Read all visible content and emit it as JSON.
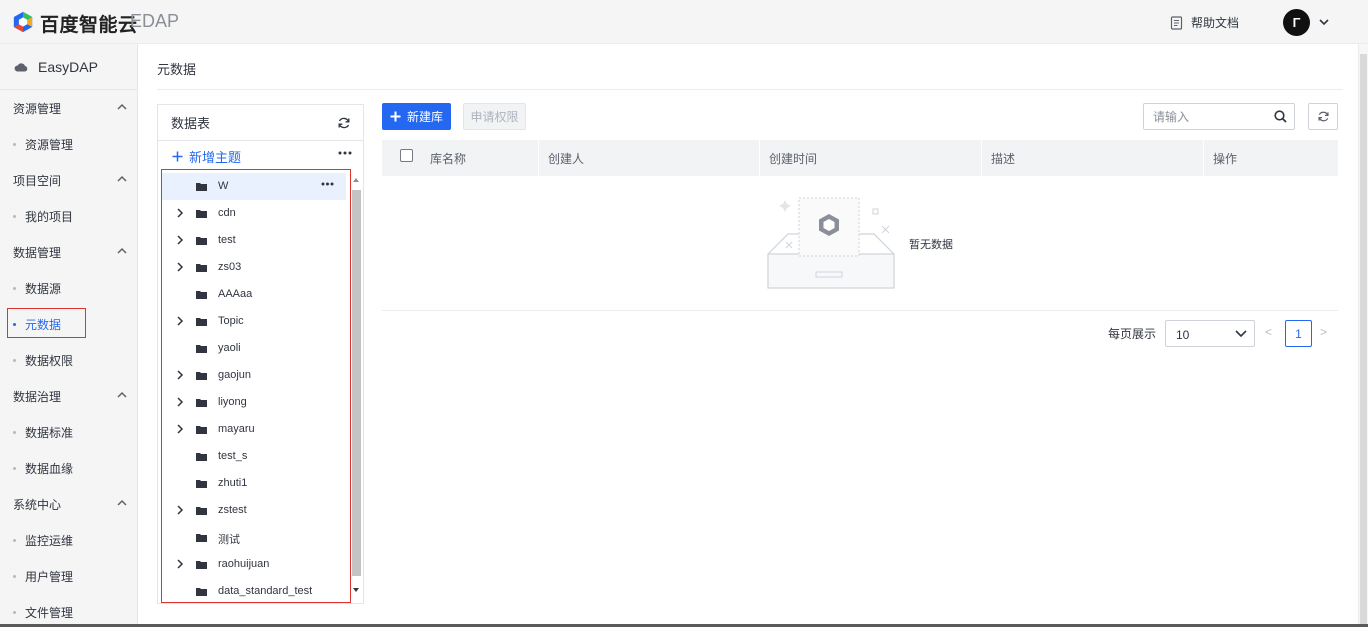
{
  "header": {
    "brand_name": "百度智能云",
    "product": "EDAP",
    "help_label": "帮助文档",
    "avatar_initial": "Γ",
    "icons": {
      "logo": "baidu-cloud-cube-logo",
      "help": "document-icon",
      "caret": "chevron-down-icon"
    }
  },
  "sidebar": {
    "brand": "EasyDAP",
    "brand_icon": "cloud-icon",
    "groups": [
      {
        "label": "资源管理",
        "items": [
          "资源管理"
        ]
      },
      {
        "label": "项目空间",
        "items": [
          "我的项目"
        ]
      },
      {
        "label": "数据管理",
        "items": [
          "数据源",
          "元数据",
          "数据权限"
        ]
      },
      {
        "label": "数据治理",
        "items": [
          "数据标准",
          "数据血缘"
        ]
      },
      {
        "label": "系统中心",
        "items": [
          "监控运维",
          "用户管理",
          "文件管理"
        ]
      }
    ],
    "active_item": "元数据"
  },
  "breadcrumb": "元数据",
  "tree": {
    "title": "数据表",
    "add_topic": "新增主题",
    "rows": [
      {
        "name": "W",
        "expandable": false,
        "selected": true
      },
      {
        "name": "cdn",
        "expandable": true
      },
      {
        "name": "test",
        "expandable": true
      },
      {
        "name": "zs03",
        "expandable": true
      },
      {
        "name": "AAAaa",
        "expandable": false
      },
      {
        "name": "Topic",
        "expandable": true
      },
      {
        "name": "yaoli",
        "expandable": false
      },
      {
        "name": "gaojun",
        "expandable": true
      },
      {
        "name": "liyong",
        "expandable": true
      },
      {
        "name": "mayaru",
        "expandable": true
      },
      {
        "name": "test_s",
        "expandable": false
      },
      {
        "name": "zhuti1",
        "expandable": false
      },
      {
        "name": "zstest",
        "expandable": true
      },
      {
        "name": "测试",
        "expandable": false
      },
      {
        "name": "raohuijuan",
        "expandable": true
      },
      {
        "name": "data_standard_test",
        "expandable": false
      }
    ]
  },
  "toolbar": {
    "new_db": "新建库",
    "apply_perm": "申请权限",
    "search_placeholder": "请输入"
  },
  "table": {
    "columns": [
      "库名称",
      "创建人",
      "创建时间",
      "描述",
      "操作"
    ],
    "empty_text": "暂无数据"
  },
  "pagination": {
    "per_page_label": "每页展示",
    "per_page": "10",
    "prev": "<",
    "current": "1",
    "next": ">"
  },
  "colors": {
    "accent": "#2468f2",
    "highlight_border": "#e0322e",
    "sidebar_bg": "#f5f5f5"
  }
}
